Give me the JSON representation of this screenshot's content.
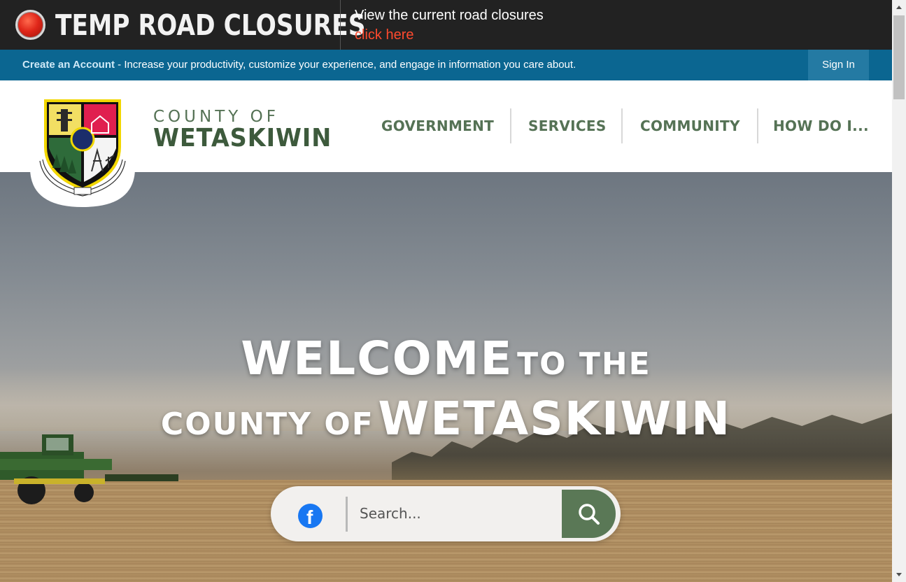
{
  "alert": {
    "title": "TEMP ROAD CLOSURES",
    "message": "View the current road closures",
    "link": "click here",
    "accent": "#e0271a"
  },
  "account_bar": {
    "create_account": "Create an Account",
    "tagline": " - Increase your productivity, customize your experience, and engage in information you care about.",
    "sign_in": "Sign In"
  },
  "brand": {
    "top": "COUNTY OF",
    "main": "WETASKIWIN",
    "seal_text": "COUNTY OF WETASKIWIN No. 10"
  },
  "nav": {
    "items": [
      "GOVERNMENT",
      "SERVICES",
      "COMMUNITY",
      "HOW DO I..."
    ]
  },
  "hero": {
    "line1_big": "WELCOME",
    "line1_small": "TO THE",
    "line2_small": "COUNTY OF",
    "line2_big": "WETASKIWIN"
  },
  "search": {
    "placeholder": "Search...",
    "social_icon": "facebook-icon",
    "button_icon": "search-icon"
  },
  "colors": {
    "alert_bg": "#222222",
    "account_bar": "#0b6691",
    "brand_green": "#3d5a3c",
    "search_button": "#5a7856"
  }
}
